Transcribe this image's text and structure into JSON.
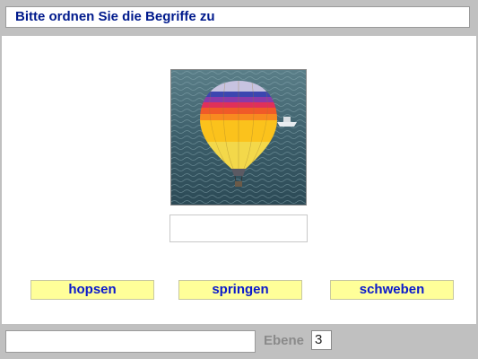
{
  "header": {
    "title": "Bitte ordnen Sie die Begriffe zu"
  },
  "exercise": {
    "image_icon": "hot-air-balloon-photo",
    "answer_value": "",
    "words": [
      "hopsen",
      "springen",
      "schweben"
    ]
  },
  "footer": {
    "status_text": "",
    "level_label": "Ebene",
    "level_value": "3"
  },
  "colors": {
    "title_text": "#001a8c",
    "word_bg": "#ffff99",
    "word_text": "#0a19cc",
    "frame": "#c0c0c0"
  }
}
